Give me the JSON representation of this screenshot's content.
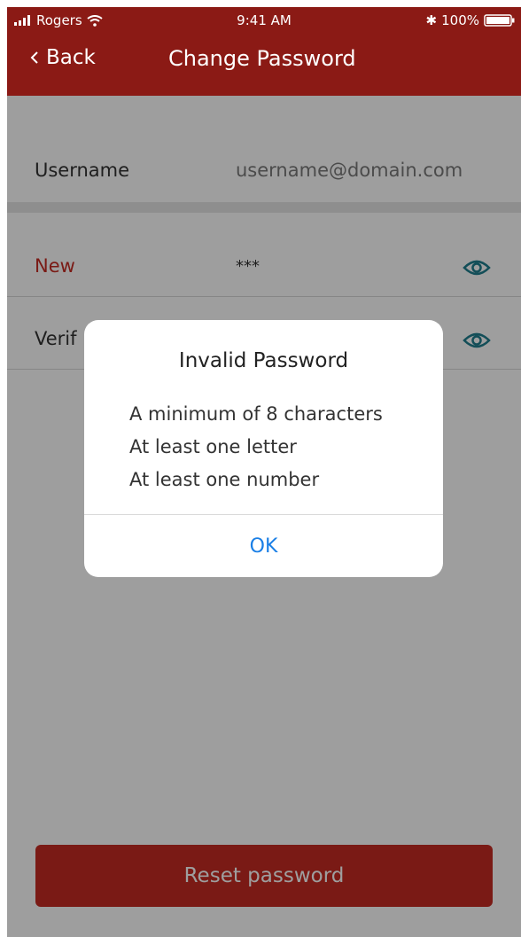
{
  "status_bar": {
    "carrier": "Rogers",
    "time": "9:41 AM",
    "battery": "100%",
    "icons": [
      "signal-icon",
      "wifi-icon",
      "bluetooth-icon",
      "battery-icon"
    ]
  },
  "nav": {
    "back_label": "Back",
    "title": "Change Password"
  },
  "form": {
    "username_label": "Username",
    "username_value": "username@domain.com",
    "new_label": "New",
    "new_value": "***",
    "verify_label": "Verif"
  },
  "alert": {
    "title": "Invalid Password",
    "lines": [
      "A minimum of 8 characters",
      "At least one letter",
      "At least one number"
    ],
    "ok_label": "OK"
  },
  "footer": {
    "reset_label": "Reset password"
  },
  "colors": {
    "brand": "#8b1a15",
    "button": "#c62b22",
    "new_label": "#c62b22",
    "icon_teal": "#1f7f8f",
    "link_blue": "#1a7fe6"
  }
}
